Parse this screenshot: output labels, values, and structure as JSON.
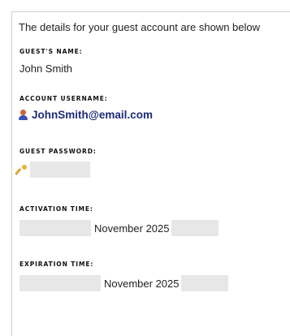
{
  "intro": "The details for your guest account are shown below",
  "guest_name": {
    "label": "GUEST'S NAME:",
    "value": "John Smith"
  },
  "account_username": {
    "label": "ACCOUNT USERNAME:",
    "value": "JohnSmith@email.com",
    "icon": "user-icon"
  },
  "guest_password": {
    "label": "GUEST PASSWORD:",
    "icon": "key-icon"
  },
  "activation_time": {
    "label": "ACTIVATION TIME:",
    "month_year": "November 2025"
  },
  "expiration_time": {
    "label": "EXPIRATION TIME:",
    "month_year": "November 2025"
  },
  "colors": {
    "username": "#1c2b78",
    "redaction": "#e7e7e7",
    "border": "#cfcfcf"
  }
}
